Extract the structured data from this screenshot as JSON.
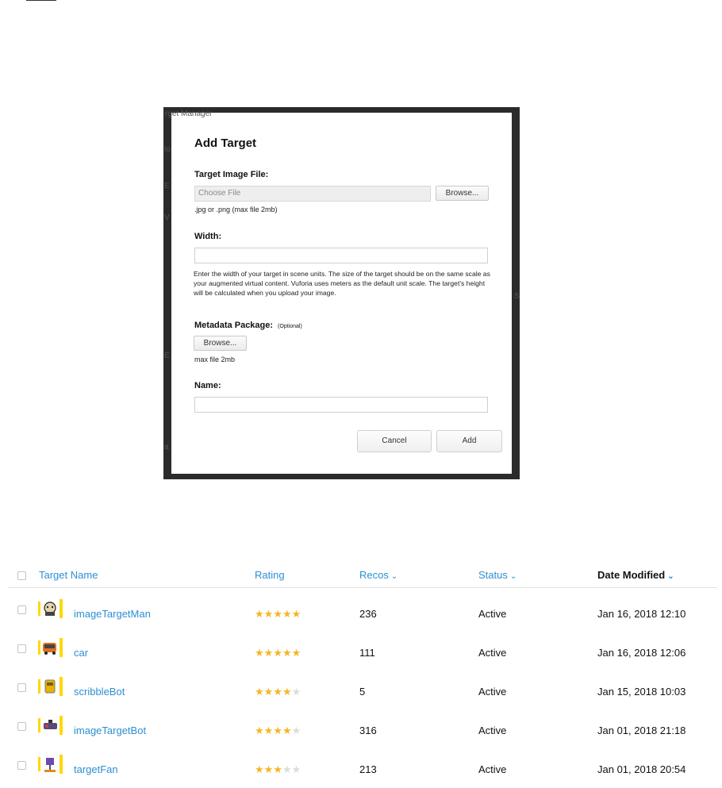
{
  "background_labels": [
    "rget Manager",
    "lo",
    "E",
    "V",
    "S",
    "E",
    "a"
  ],
  "modal": {
    "title": "Add Target",
    "image_file_label": "Target Image File:",
    "choose_file_placeholder": "Choose File",
    "browse_label": "Browse...",
    "image_file_hint": ".jpg or .png (max file 2mb)",
    "width_label": "Width:",
    "width_value": "",
    "width_help": "Enter the width of your target in scene units. The size of the target should be on the same scale as your augmented virtual content. Vuforia uses meters as the default unit scale. The target's height will be calculated when you upload your image.",
    "metadata_label": "Metadata Package:",
    "metadata_optional": "(Optional)",
    "metadata_browse_label": "Browse...",
    "metadata_hint": "max file 2mb",
    "name_label": "Name:",
    "name_value": "",
    "cancel_label": "Cancel",
    "add_label": "Add"
  },
  "table": {
    "headers": {
      "target_name": "Target Name",
      "rating": "Rating",
      "recos": "Recos",
      "status": "Status",
      "date_modified": "Date Modified"
    },
    "rows": [
      {
        "name": "imageTargetMan",
        "rating": 5,
        "recos": "236",
        "status": "Active",
        "date": "Jan 16, 2018 12:10",
        "thumb": "man-thumbnail"
      },
      {
        "name": "car",
        "rating": 5,
        "recos": "111",
        "status": "Active",
        "date": "Jan 16, 2018 12:06",
        "thumb": "car-thumbnail"
      },
      {
        "name": "scribbleBot",
        "rating": 4,
        "recos": "5",
        "status": "Active",
        "date": "Jan 15, 2018 10:03",
        "thumb": "scribblebot-thumbnail"
      },
      {
        "name": "imageTargetBot",
        "rating": 4,
        "recos": "316",
        "status": "Active",
        "date": "Jan 01, 2018 21:18",
        "thumb": "bot-thumbnail"
      },
      {
        "name": "targetFan",
        "rating": 3,
        "recos": "213",
        "status": "Active",
        "date": "Jan 01, 2018 20:54",
        "thumb": "fan-thumbnail"
      }
    ]
  },
  "colors": {
    "link": "#2d8fd2",
    "star_on": "#f5b623",
    "star_off": "#dcdcdc",
    "modal_frame": "#2b2b2b"
  }
}
